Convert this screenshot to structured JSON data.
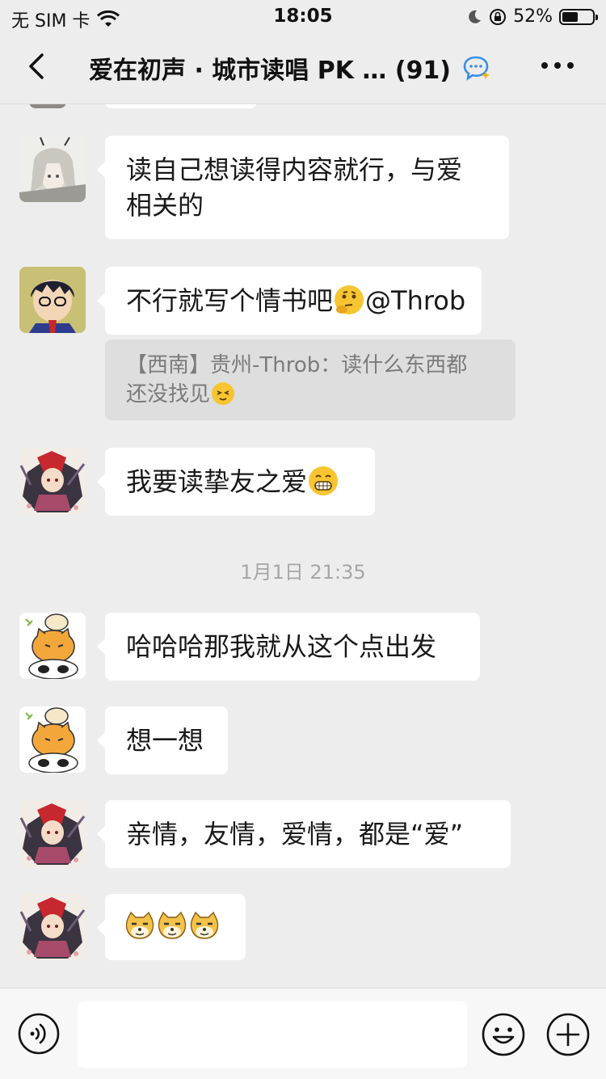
{
  "status_bar": {
    "carrier": "无 SIM 卡",
    "time": "18:05",
    "battery": "52%",
    "battery_level": 0.52
  },
  "header": {
    "title": "爱在初声 · 城市读唱 PK … (91)",
    "back_icon": "chevron-left-icon",
    "chat_icon": "chat-bubble-icon",
    "more_icon": "more-dots-icon"
  },
  "messages": [
    {
      "type": "text",
      "avatar": "avatar-white-hair",
      "lines": [
        "读自己想读得内容就行，与爱",
        "相关的"
      ]
    },
    {
      "type": "text",
      "avatar": "avatar-conan",
      "text": "不行就写个情书吧",
      "emoji": "thinking-face-icon",
      "suffix": "@Throb"
    },
    {
      "type": "quote",
      "text_line1": "【西南】贵州-Throb：读什么东西都",
      "text_line2": "还没找见",
      "emoji": "squinting-face-icon"
    },
    {
      "type": "text",
      "avatar": "avatar-red-hair",
      "text": "我要读挚友之爱",
      "emoji": "grinning-face-icon"
    },
    {
      "type": "timestamp",
      "text": "1月1日 21:35"
    },
    {
      "type": "text",
      "avatar": "avatar-cat",
      "text": "哈哈哈那我就从这个点出发"
    },
    {
      "type": "text",
      "avatar": "avatar-cat",
      "text": "想一想"
    },
    {
      "type": "text",
      "avatar": "avatar-red-hair",
      "text": "亲情，友情，爱情，都是“爱”"
    },
    {
      "type": "emoji",
      "avatar": "avatar-red-hair",
      "emoji": "doge-icon",
      "count": 3
    }
  ],
  "input_bar": {
    "voice_icon": "voice-icon",
    "emoji_icon": "emoji-icon",
    "plus_icon": "plus-icon",
    "placeholder": ""
  }
}
